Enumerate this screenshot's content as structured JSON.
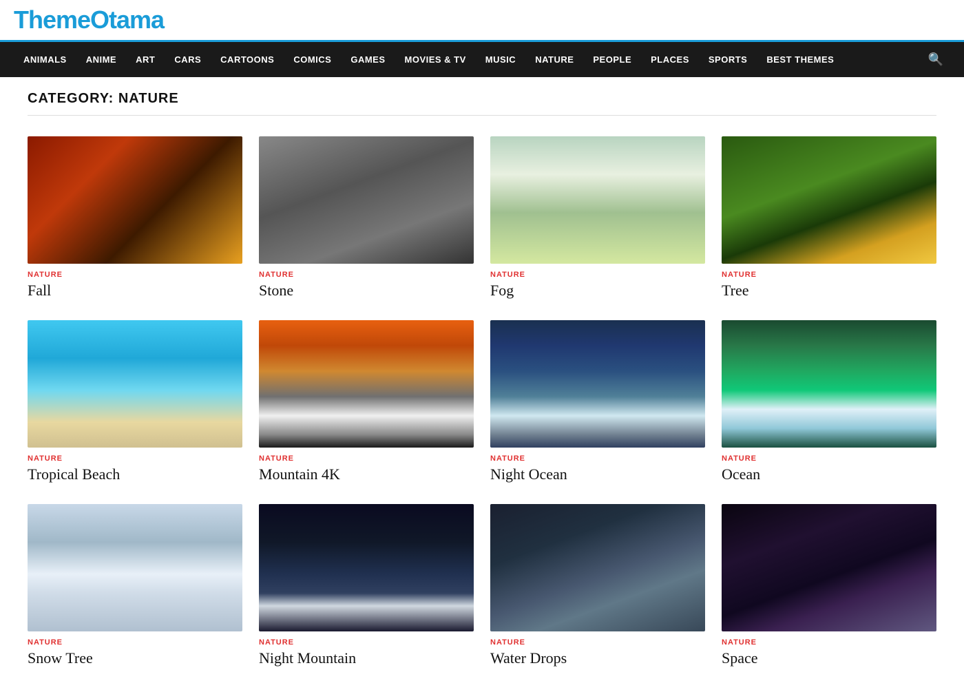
{
  "logo": {
    "text": "ThemeOtama"
  },
  "nav": {
    "items": [
      {
        "label": "ANIMALS",
        "href": "#"
      },
      {
        "label": "ANIME",
        "href": "#"
      },
      {
        "label": "ART",
        "href": "#"
      },
      {
        "label": "CARS",
        "href": "#"
      },
      {
        "label": "CARTOONS",
        "href": "#"
      },
      {
        "label": "COMICS",
        "href": "#"
      },
      {
        "label": "GAMES",
        "href": "#"
      },
      {
        "label": "MOVIES & TV",
        "href": "#"
      },
      {
        "label": "MUSIC",
        "href": "#"
      },
      {
        "label": "NATURE",
        "href": "#"
      },
      {
        "label": "PEOPLE",
        "href": "#"
      },
      {
        "label": "PLACES",
        "href": "#"
      },
      {
        "label": "SPORTS",
        "href": "#"
      },
      {
        "label": "BEST THEMES",
        "href": "#"
      }
    ]
  },
  "page": {
    "category_label": "CATEGORY: NATURE"
  },
  "cards": [
    {
      "id": "fall",
      "category": "NATURE",
      "title": "Fall",
      "img_class": "img-fall"
    },
    {
      "id": "stone",
      "category": "NATURE",
      "title": "Stone",
      "img_class": "img-stone"
    },
    {
      "id": "fog",
      "category": "NATURE",
      "title": "Fog",
      "img_class": "img-fog"
    },
    {
      "id": "tree",
      "category": "NATURE",
      "title": "Tree",
      "img_class": "img-tree"
    },
    {
      "id": "tropical-beach",
      "category": "NATURE",
      "title": "Tropical Beach",
      "img_class": "img-beach"
    },
    {
      "id": "mountain-4k",
      "category": "NATURE",
      "title": "Mountain 4K",
      "img_class": "img-mountain"
    },
    {
      "id": "night-ocean",
      "category": "NATURE",
      "title": "Night Ocean",
      "img_class": "img-night-ocean"
    },
    {
      "id": "ocean",
      "category": "NATURE",
      "title": "Ocean",
      "img_class": "img-ocean"
    },
    {
      "id": "snow-tree",
      "category": "NATURE",
      "title": "Snow Tree",
      "img_class": "img-snow-tree"
    },
    {
      "id": "night-mountain",
      "category": "NATURE",
      "title": "Night Mountain",
      "img_class": "img-night-mountain"
    },
    {
      "id": "water-drops",
      "category": "NATURE",
      "title": "Water Drops",
      "img_class": "img-water-drops"
    },
    {
      "id": "space",
      "category": "NATURE",
      "title": "Space",
      "img_class": "img-space"
    }
  ]
}
